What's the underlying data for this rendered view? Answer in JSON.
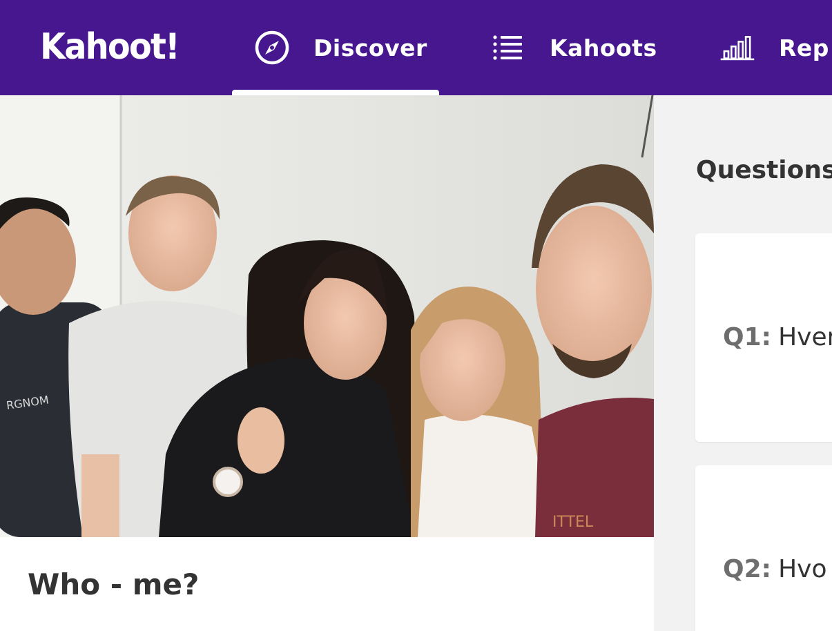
{
  "brand": {
    "logo_text": "Kahoot!",
    "accent": "#46178f"
  },
  "nav": {
    "items": [
      {
        "label": "Discover",
        "icon": "compass-icon",
        "active": true
      },
      {
        "label": "Kahoots",
        "icon": "list-icon",
        "active": false
      },
      {
        "label": "Rep",
        "icon": "bar-chart-icon",
        "active": false
      }
    ]
  },
  "kahoot": {
    "title": "Who - me?"
  },
  "questions": {
    "heading": "Questions",
    "items": [
      {
        "number": "Q1:",
        "text": "Hver"
      },
      {
        "number": "Q2:",
        "text": "Hvo"
      }
    ]
  }
}
